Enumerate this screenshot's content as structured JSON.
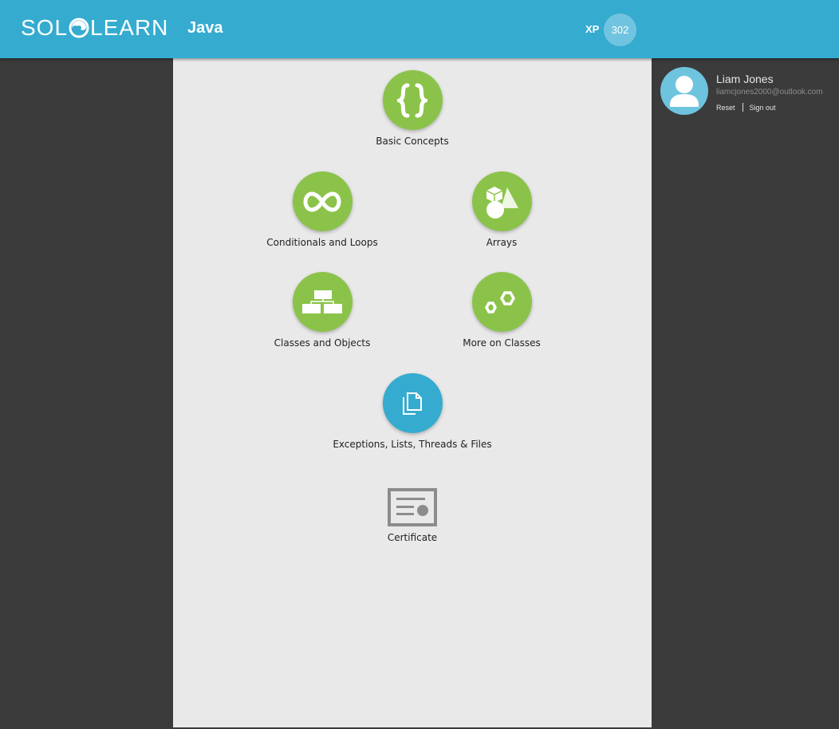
{
  "header": {
    "logo_left": "SOL",
    "logo_right": "LEARN",
    "course_title": "Java",
    "xp_label": "XP",
    "xp_value": "302"
  },
  "modules": [
    {
      "label": "Basic Concepts",
      "icon": "braces-icon",
      "status": "completed"
    },
    {
      "label": "Conditionals and Loops",
      "icon": "infinity-icon",
      "status": "completed"
    },
    {
      "label": "Arrays",
      "icon": "shapes-icon",
      "status": "completed"
    },
    {
      "label": "Classes and Objects",
      "icon": "hierarchy-icon",
      "status": "completed"
    },
    {
      "label": "More on Classes",
      "icon": "hexagons-icon",
      "status": "completed"
    },
    {
      "label": "Exceptions, Lists, Threads & Files",
      "icon": "copy-pages-icon",
      "status": "current"
    },
    {
      "label": "Certificate",
      "icon": "certificate-icon",
      "status": "locked"
    }
  ],
  "profile": {
    "name": "Liam Jones",
    "email": "liamcjones2000@outlook.com",
    "reset_label": "Reset",
    "signout_label": "Sign out"
  },
  "colors": {
    "header": "#35abcf",
    "completed": "#8bc34a",
    "current": "#35abcf",
    "panel": "#e9e9e9",
    "background": "#3b3b3b"
  }
}
